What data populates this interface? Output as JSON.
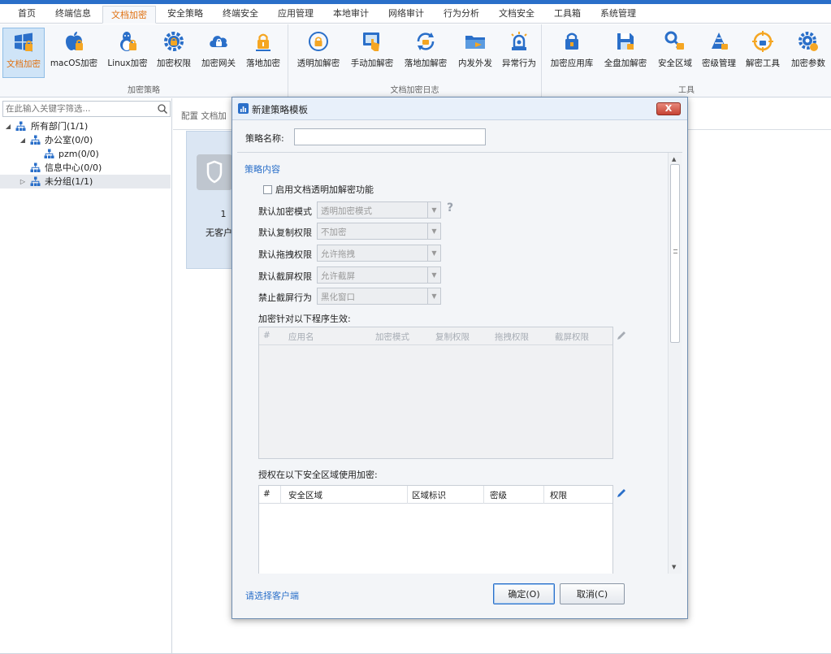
{
  "menu": {
    "tabs": [
      "首页",
      "终端信息",
      "文档加密",
      "安全策略",
      "终端安全",
      "应用管理",
      "本地审计",
      "网络审计",
      "行为分析",
      "文档安全",
      "工具箱",
      "系统管理"
    ],
    "active_index": 2
  },
  "ribbon": {
    "group1": {
      "label": "加密策略",
      "buttons": [
        "文档加密",
        "macOS加密",
        "Linux加密",
        "加密权限",
        "加密网关",
        "落地加密"
      ]
    },
    "group2": {
      "label": "文档加密日志",
      "buttons": [
        "透明加解密",
        "手动加解密",
        "落地加解密",
        "内发外发",
        "异常行为"
      ]
    },
    "group3": {
      "label": "工具",
      "buttons": [
        "加密应用库",
        "全盘加解密",
        "安全区域",
        "密级管理",
        "解密工具",
        "加密参数"
      ]
    },
    "colors": {
      "accent": "#2a6fc9",
      "orange": "#f5a623",
      "active_text": "#e0700f"
    }
  },
  "left_panel": {
    "search_placeholder": "在此输入关键字筛选...",
    "tree": {
      "root": "所有部门(1/1)",
      "office": "办公室(0/0)",
      "pzm": "pzm(0/0)",
      "info_center": "信息中心(0/0)",
      "ungrouped": "未分组(1/1)"
    }
  },
  "main": {
    "breadcrumb": "配置 文档加",
    "tile": {
      "number": "1",
      "text": "无客户端"
    }
  },
  "dialog": {
    "title": "新建策略模板",
    "close_label": "X",
    "name_label": "策略名称:",
    "name_value": "",
    "section_title": "策略内容",
    "enable_checkbox_label": "启用文档透明加解密功能",
    "fields": {
      "encrypt_mode": {
        "label": "默认加密模式",
        "value": "透明加密模式"
      },
      "copy_perm": {
        "label": "默认复制权限",
        "value": "不加密"
      },
      "drag_perm": {
        "label": "默认拖拽权限",
        "value": "允许拖拽"
      },
      "screenshot_perm": {
        "label": "默认截屏权限",
        "value": "允许截屏"
      },
      "forbid_screenshot": {
        "label": "禁止截屏行为",
        "value": "黑化窗口"
      }
    },
    "programs_label": "加密针对以下程序生效:",
    "programs_table": {
      "columns": [
        "#",
        "应用名",
        "加密模式",
        "复制权限",
        "拖拽权限",
        "截屏权限"
      ]
    },
    "zones_label": "授权在以下安全区域使用加密:",
    "zones_table": {
      "columns": [
        "#",
        "安全区域",
        "区域标识",
        "密级",
        "权限"
      ]
    },
    "select_client_link": "请选择客户端",
    "ok_label": "确定(O)",
    "cancel_label": "取消(C)"
  }
}
